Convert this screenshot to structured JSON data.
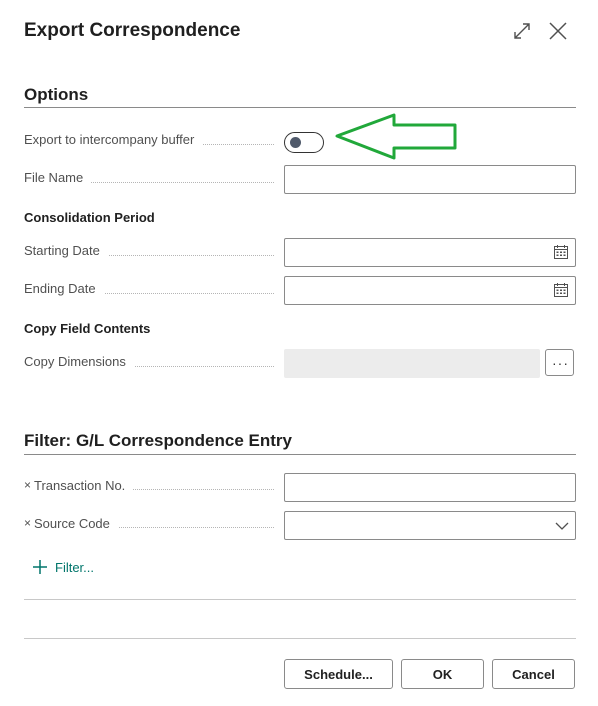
{
  "dialog": {
    "title": "Export Correspondence",
    "expand_icon": "expand-icon",
    "close_icon": "close-icon"
  },
  "options": {
    "section_title": "Options",
    "export_ic_buffer": {
      "label": "Export to intercompany buffer",
      "value": false
    },
    "file_name": {
      "label": "File Name",
      "value": ""
    },
    "consolidation_period": {
      "heading": "Consolidation Period",
      "starting_date": {
        "label": "Starting Date",
        "value": ""
      },
      "ending_date": {
        "label": "Ending Date",
        "value": ""
      }
    },
    "copy_field_contents": {
      "heading": "Copy Field Contents",
      "copy_dimensions": {
        "label": "Copy Dimensions",
        "value": "",
        "more_button": "···"
      }
    }
  },
  "filter": {
    "section_title": "Filter: G/L Correspondence Entry",
    "transaction_no": {
      "remove_mark": "×",
      "label": "Transaction No.",
      "value": ""
    },
    "source_code": {
      "remove_mark": "×",
      "label": "Source Code",
      "value": ""
    },
    "add_filter_label": "Filter..."
  },
  "footer": {
    "schedule_label": "Schedule...",
    "ok_label": "OK",
    "cancel_label": "Cancel"
  },
  "colors": {
    "accent": "#00756b",
    "annotation_arrow": "#21a83a",
    "toggle_knob": "#505a6b"
  }
}
